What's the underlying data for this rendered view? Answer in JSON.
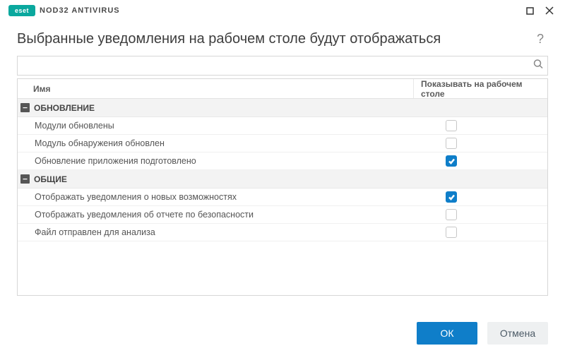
{
  "brand": {
    "badge": "eset",
    "product": "NOD32 ANTIVIRUS"
  },
  "header": {
    "title": "Выбранные уведомления на рабочем столе будут отображаться",
    "help": "?"
  },
  "search": {
    "value": "",
    "placeholder": ""
  },
  "columns": {
    "name": "Имя",
    "show_on_desktop": "Показывать на рабочем столе"
  },
  "groups": [
    {
      "label": "ОБНОВЛЕНИЕ",
      "expanded": true,
      "items": [
        {
          "label": "Модули обновлены",
          "checked": false
        },
        {
          "label": "Модуль обнаружения обновлен",
          "checked": false
        },
        {
          "label": "Обновление приложения подготовлено",
          "checked": true
        }
      ]
    },
    {
      "label": "ОБЩИЕ",
      "expanded": true,
      "items": [
        {
          "label": "Отображать уведомления о новых возможностях",
          "checked": true
        },
        {
          "label": "Отображать уведомления об отчете по безопасности",
          "checked": false
        },
        {
          "label": "Файл отправлен для анализа",
          "checked": false
        }
      ]
    }
  ],
  "footer": {
    "ok": "ОК",
    "cancel": "Отмена"
  }
}
